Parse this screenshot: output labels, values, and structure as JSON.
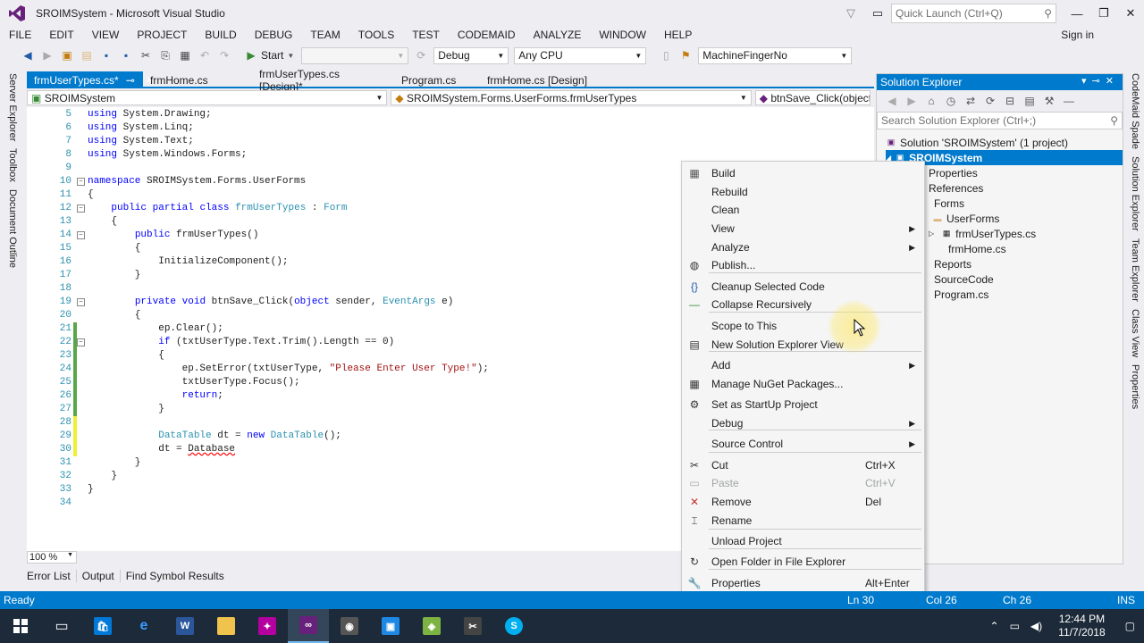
{
  "window": {
    "title": "SROIMSystem - Microsoft Visual Studio",
    "quick_launch_placeholder": "Quick Launch (Ctrl+Q)"
  },
  "menu": {
    "items": [
      "FILE",
      "EDIT",
      "VIEW",
      "PROJECT",
      "BUILD",
      "DEBUG",
      "TEAM",
      "TOOLS",
      "TEST",
      "CODEMAID",
      "ANALYZE",
      "WINDOW",
      "HELP"
    ],
    "sign_in": "Sign in"
  },
  "toolbar": {
    "start_label": "Start",
    "config": "Debug",
    "platform": "Any CPU",
    "startup_project": "MachineFingerNo"
  },
  "left_sidebar": [
    "Server Explorer",
    "Toolbox",
    "Document Outline"
  ],
  "right_sidebar": [
    "CodeMaid Spade",
    "Solution Explorer",
    "Team Explorer",
    "Class View",
    "Properties"
  ],
  "doc_tabs": [
    {
      "label": "frmUserTypes.cs*",
      "active": true
    },
    {
      "label": "frmHome.cs",
      "active": false
    },
    {
      "label": "frmUserTypes.cs [Design]*",
      "active": false
    },
    {
      "label": "Program.cs",
      "active": false
    },
    {
      "label": "frmHome.cs [Design]",
      "active": false
    }
  ],
  "nav": {
    "project": "SROIMSystem",
    "type": "SROIMSystem.Forms.UserForms.frmUserTypes",
    "member": "btnSave_Click(object s"
  },
  "code_lines": [
    {
      "n": "5",
      "t": "using System.Drawing;"
    },
    {
      "n": "6",
      "t": "using System.Linq;"
    },
    {
      "n": "7",
      "t": "using System.Text;"
    },
    {
      "n": "8",
      "t": "using System.Windows.Forms;"
    },
    {
      "n": "9",
      "t": ""
    },
    {
      "n": "10",
      "t": "namespace SROIMSystem.Forms.UserForms"
    },
    {
      "n": "11",
      "t": "{"
    },
    {
      "n": "12",
      "t": "    public partial class frmUserTypes : Form"
    },
    {
      "n": "13",
      "t": "    {"
    },
    {
      "n": "14",
      "t": "        public frmUserTypes()"
    },
    {
      "n": "15",
      "t": "        {"
    },
    {
      "n": "16",
      "t": "            InitializeComponent();"
    },
    {
      "n": "17",
      "t": "        }"
    },
    {
      "n": "18",
      "t": ""
    },
    {
      "n": "19",
      "t": "        private void btnSave_Click(object sender, EventArgs e)"
    },
    {
      "n": "20",
      "t": "        {"
    },
    {
      "n": "21",
      "t": "            ep.Clear();"
    },
    {
      "n": "22",
      "t": "            if (txtUserType.Text.Trim().Length == 0)"
    },
    {
      "n": "23",
      "t": "            {"
    },
    {
      "n": "24",
      "t": "                ep.SetError(txtUserType, \"Please Enter User Type!\");"
    },
    {
      "n": "25",
      "t": "                txtUserType.Focus();"
    },
    {
      "n": "26",
      "t": "                return;"
    },
    {
      "n": "27",
      "t": "            }"
    },
    {
      "n": "28",
      "t": ""
    },
    {
      "n": "29",
      "t": "            DataTable dt = new DataTable();"
    },
    {
      "n": "30",
      "t": "            dt = Database"
    },
    {
      "n": "31",
      "t": "        }"
    },
    {
      "n": "32",
      "t": "    }"
    },
    {
      "n": "33",
      "t": "}"
    },
    {
      "n": "34",
      "t": ""
    }
  ],
  "zoom": "100 %",
  "bottom_tabs": [
    "Error List",
    "Output",
    "Find Symbol Results"
  ],
  "status": {
    "state": "Ready",
    "line": "Ln 30",
    "col": "Col 26",
    "ch": "Ch 26",
    "mode": "INS"
  },
  "solution_explorer": {
    "title": "Solution Explorer",
    "search_placeholder": "Search Solution Explorer (Ctrl+;)",
    "nodes": [
      "Solution 'SROIMSystem' (1 project)",
      "SROIMSystem",
      "Properties",
      "References",
      "Forms",
      "UserForms",
      "frmUserTypes.cs",
      "frmHome.cs",
      "Reports",
      "SourceCode",
      "Program.cs"
    ]
  },
  "context_menu": {
    "items": [
      {
        "label": "Build",
        "icon": "build-icon"
      },
      {
        "label": "Rebuild",
        "icon": ""
      },
      {
        "label": "Clean",
        "icon": ""
      },
      {
        "label": "View",
        "icon": "",
        "submenu": true
      },
      {
        "label": "Analyze",
        "icon": "",
        "submenu": true
      },
      {
        "label": "Publish...",
        "icon": "publish-icon"
      },
      {
        "label": "Cleanup Selected Code",
        "icon": "braces-icon"
      },
      {
        "label": "Collapse Recursively",
        "icon": "minus-icon"
      },
      {
        "label": "Scope to This",
        "icon": ""
      },
      {
        "label": "New Solution Explorer View",
        "icon": "new-view-icon"
      },
      {
        "label": "Add",
        "icon": "",
        "submenu": true
      },
      {
        "label": "Manage NuGet Packages...",
        "icon": "nuget-icon"
      },
      {
        "label": "Set as StartUp Project",
        "icon": "gear-icon"
      },
      {
        "label": "Debug",
        "icon": "",
        "submenu": true
      },
      {
        "label": "Source Control",
        "icon": "",
        "submenu": true
      },
      {
        "label": "Cut",
        "shortcut": "Ctrl+X",
        "icon": "scissors-icon"
      },
      {
        "label": "Paste",
        "shortcut": "Ctrl+V",
        "icon": "paste-icon",
        "disabled": true
      },
      {
        "label": "Remove",
        "shortcut": "Del",
        "icon": "remove-icon"
      },
      {
        "label": "Rename",
        "icon": "rename-icon"
      },
      {
        "label": "Unload Project",
        "icon": ""
      },
      {
        "label": "Open Folder in File Explorer",
        "icon": "refresh-icon"
      },
      {
        "label": "Properties",
        "shortcut": "Alt+Enter",
        "icon": "wrench-icon"
      }
    ]
  },
  "taskbar": {
    "time": "12:44 PM",
    "date": "11/7/2018"
  },
  "colors": {
    "accent": "#007acc",
    "keyword": "#0000ff",
    "type": "#2b91af",
    "string": "#a31515"
  }
}
